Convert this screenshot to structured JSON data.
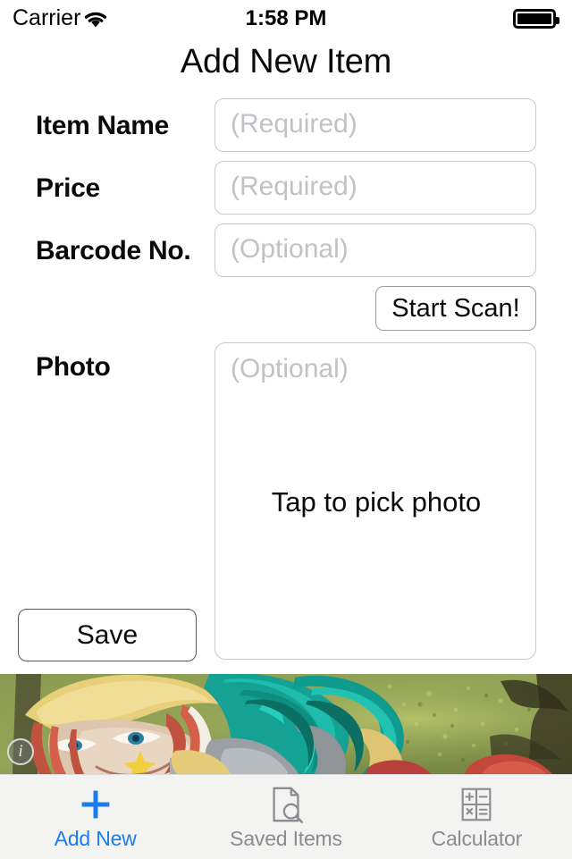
{
  "status_bar": {
    "carrier": "Carrier",
    "wifi_icon": "wifi-icon",
    "time": "1:58 PM",
    "battery_icon": "battery-full-icon"
  },
  "header": {
    "title": "Add New Item"
  },
  "form": {
    "fields": [
      {
        "label": "Item Name",
        "placeholder": "(Required)",
        "value": ""
      },
      {
        "label": "Price",
        "placeholder": "(Required)",
        "value": ""
      },
      {
        "label": "Barcode No.",
        "placeholder": "(Optional)",
        "value": ""
      }
    ],
    "scan_button": "Start Scan!",
    "photo": {
      "label": "Photo",
      "placeholder": "(Optional)",
      "action_text": "Tap to pick photo"
    },
    "save_button": "Save"
  },
  "ad": {
    "info_icon": "info-circle-icon",
    "info_glyph": "i"
  },
  "tab_bar": {
    "tabs": [
      {
        "label": "Add New",
        "icon": "plus-icon",
        "active": true
      },
      {
        "label": "Saved Items",
        "icon": "document-search-icon",
        "active": false
      },
      {
        "label": "Calculator",
        "icon": "calculator-icon",
        "active": false
      }
    ]
  },
  "colors": {
    "accent_blue": "#1a7ced",
    "inactive_gray": "#8b8b90",
    "field_border": "#c9c9cc",
    "placeholder": "#c2c2c6",
    "tabbar_bg": "#f3f3f2"
  }
}
